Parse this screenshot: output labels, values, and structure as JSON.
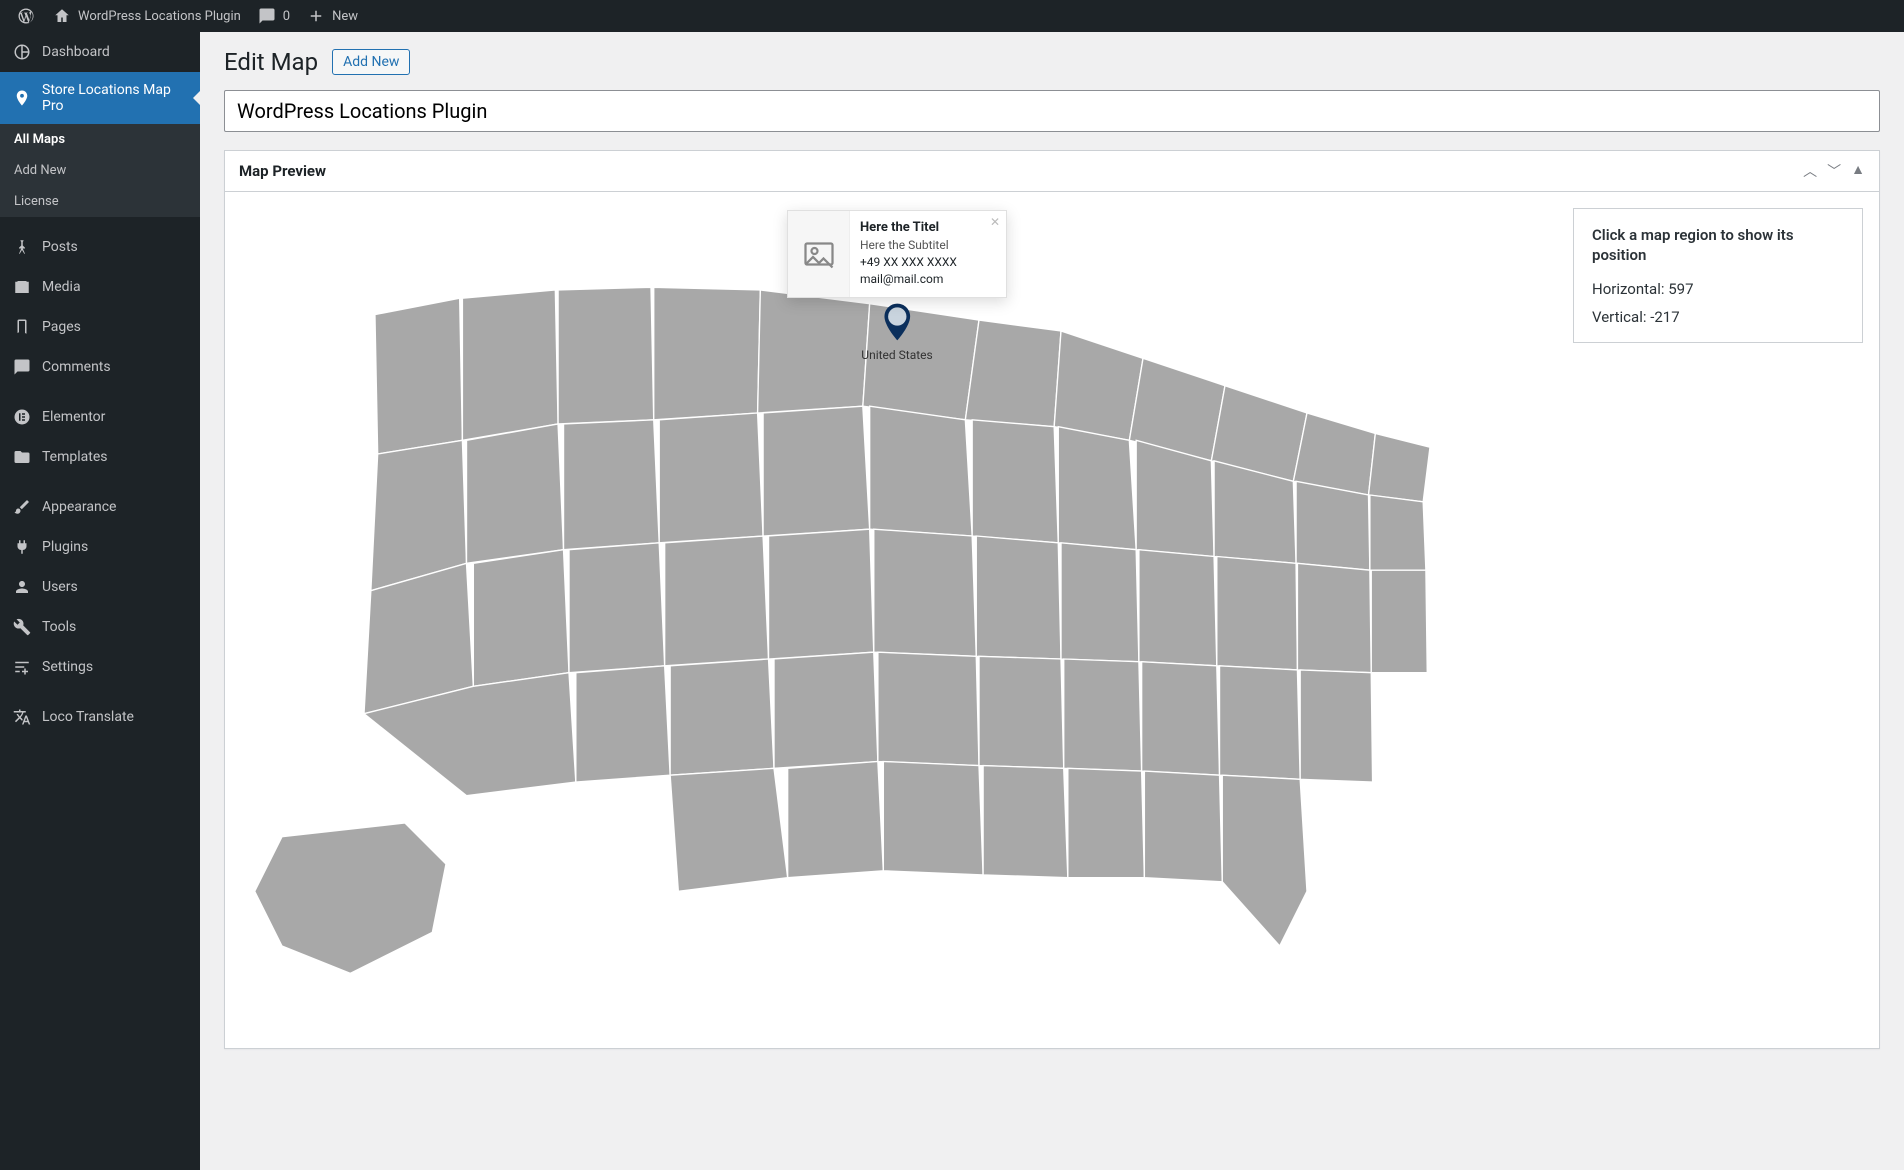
{
  "topbar": {
    "site_name": "WordPress Locations Plugin",
    "comments_count": "0",
    "new_label": "New"
  },
  "sidebar": {
    "dashboard": "Dashboard",
    "store_locations": "Store Locations Map Pro",
    "sub": {
      "all_maps": "All Maps",
      "add_new": "Add New",
      "license": "License"
    },
    "posts": "Posts",
    "media": "Media",
    "pages": "Pages",
    "comments": "Comments",
    "elementor": "Elementor",
    "templates": "Templates",
    "appearance": "Appearance",
    "plugins": "Plugins",
    "users": "Users",
    "tools": "Tools",
    "settings": "Settings",
    "loco": "Loco Translate"
  },
  "page": {
    "title": "Edit Map",
    "add_new": "Add New",
    "map_title": "WordPress Locations Plugin"
  },
  "panel": {
    "title": "Map Preview"
  },
  "pin": {
    "label": "United States"
  },
  "tooltip": {
    "title": "Here the Titel",
    "subtitle": "Here the Subtitel",
    "phone": "+49 XX XXX XXXX",
    "email": "mail@mail.com"
  },
  "info": {
    "hint": "Click a map region to show its position",
    "h_label": "Horizontal: ",
    "h_value": "597",
    "v_label": "Vertical: ",
    "v_value": "-217"
  }
}
